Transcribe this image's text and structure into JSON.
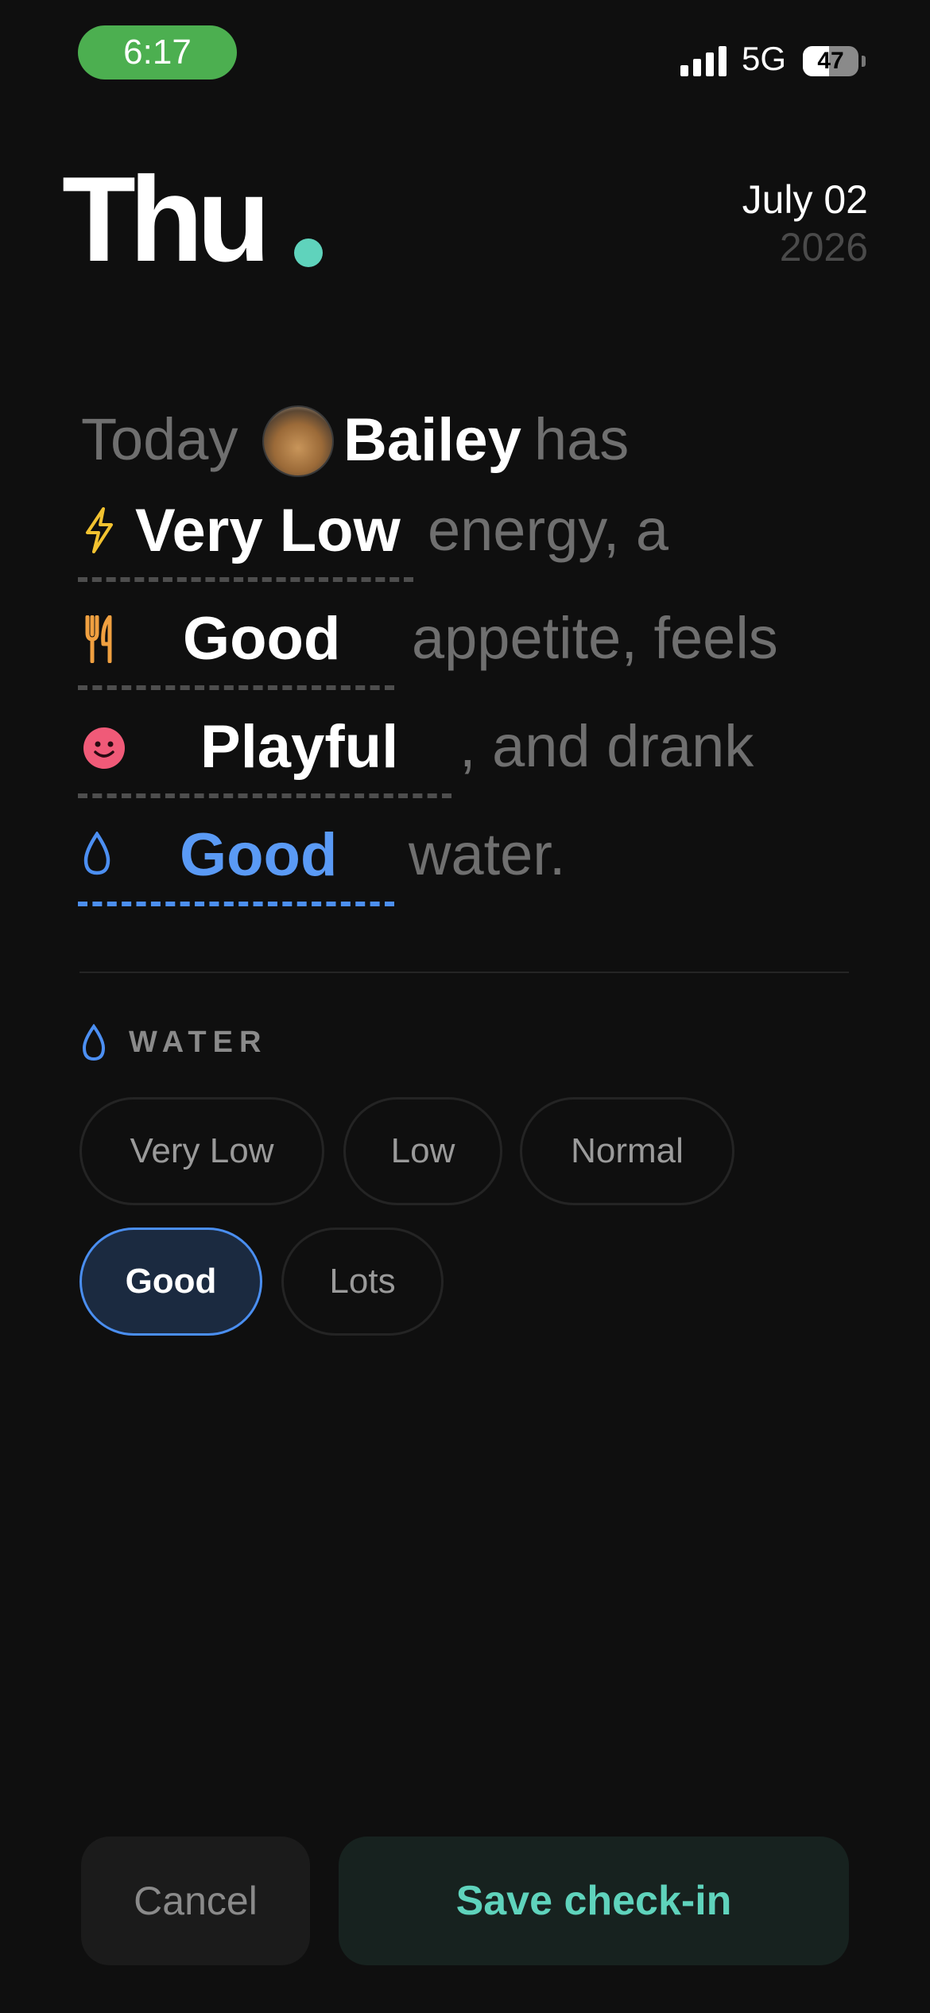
{
  "status_bar": {
    "time": "6:17",
    "network": "5G",
    "battery": "47",
    "battery_level": 0.47
  },
  "header": {
    "day": "Thu",
    "date_month_day": "July 02",
    "year": "2026"
  },
  "sentence": {
    "today": "Today",
    "pet_name": "Bailey",
    "has": "has",
    "energy_value": "Very Low",
    "energy_suffix": "energy, a",
    "appetite_value": "Good",
    "appetite_suffix": "appetite, feels",
    "mood_value": "Playful",
    "mood_suffix": ", and drank",
    "water_value": "Good",
    "water_suffix": "water."
  },
  "water_section": {
    "title": "WATER",
    "options": [
      "Very Low",
      "Low",
      "Normal",
      "Good",
      "Lots"
    ],
    "selected": "Good"
  },
  "buttons": {
    "cancel": "Cancel",
    "save": "Save check-in"
  },
  "colors": {
    "accent": "#5fd3bc",
    "water_blue": "#4c8ff2",
    "energy_yellow": "#f2c230",
    "appetite_orange": "#f0a040",
    "mood_pink": "#f05a78"
  },
  "icons": [
    "signal-icon",
    "battery-icon",
    "bolt-icon",
    "fork-knife-icon",
    "smiley-icon",
    "water-drop-icon"
  ]
}
